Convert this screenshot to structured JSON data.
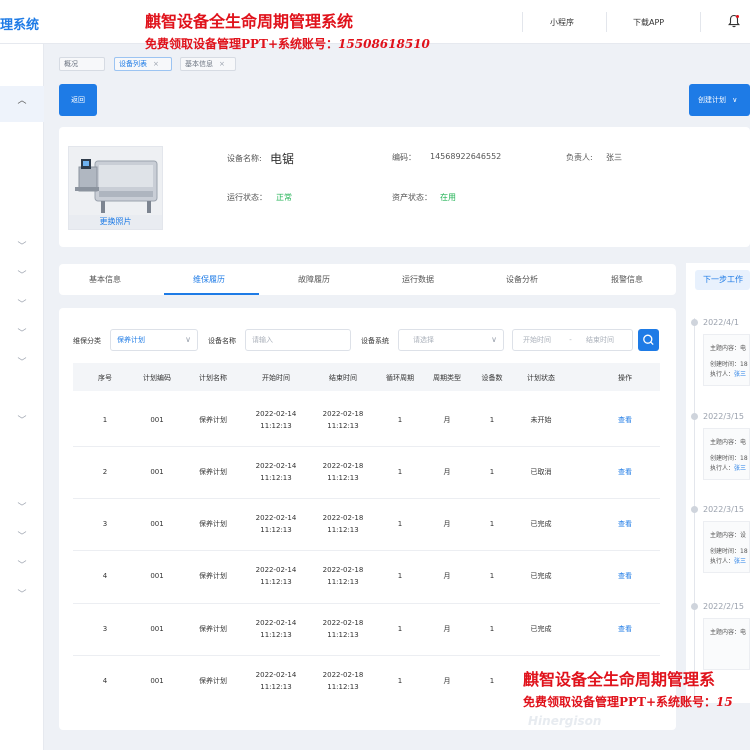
{
  "header": {
    "brand": "理系统",
    "links": [
      "小程序",
      "下载APP"
    ]
  },
  "watermark": {
    "title": "麒智设备全生命周期管理系统",
    "sub_prefix": "免费领取设备管理PPT+系统账号：",
    "phone": "15508618510",
    "title2": "麒智设备全生命周期管理系",
    "sub2_prefix": "免费领取设备管理PPT+系统账号：",
    "phone2": "15",
    "logo_text": "Hinergison"
  },
  "breadcrumbs": [
    "概况",
    "设备列表",
    "基本信息"
  ],
  "buttons": {
    "back": "返回",
    "create_plan": "创建计划"
  },
  "equipment": {
    "photo_caption": "更换照片",
    "name_label": "设备名称:",
    "name_value": "电锯",
    "code_label": "编码：",
    "code_value": "14568922646552",
    "owner_label": "负责人:",
    "owner_value": "张三",
    "run_label": "运行状态：",
    "run_value": "正常",
    "asset_label": "资产状态：",
    "asset_value": "在用"
  },
  "tabs": [
    "基本信息",
    "维保履历",
    "故障履历",
    "运行数据",
    "设备分析",
    "报警信息"
  ],
  "filters": {
    "category_label": "维保分类",
    "category_value": "保养计划",
    "name_label": "设备名称",
    "name_placeholder": "请输入",
    "system_label": "设备系统",
    "system_placeholder": "请选择",
    "start_placeholder": "开始时间",
    "range_sep": "-",
    "end_placeholder": "结束时间"
  },
  "table": {
    "columns": [
      "序号",
      "计划编码",
      "计划名称",
      "开始时间",
      "结束时间",
      "循环周期",
      "周期类型",
      "设备数",
      "计划状态",
      "操作"
    ],
    "rows": [
      {
        "idx": "1",
        "code": "001",
        "name": "保养计划",
        "start_date": "2022-02-14",
        "start_time": "11:12:13",
        "end_date": "2022-02-18",
        "end_time": "11:12:13",
        "cycle": "1",
        "cycle_type": "月",
        "devices": "1",
        "status": "未开始",
        "action": "查看"
      },
      {
        "idx": "2",
        "code": "001",
        "name": "保养计划",
        "start_date": "2022-02-14",
        "start_time": "11:12:13",
        "end_date": "2022-02-18",
        "end_time": "11:12:13",
        "cycle": "1",
        "cycle_type": "月",
        "devices": "1",
        "status": "已取消",
        "action": "查看"
      },
      {
        "idx": "3",
        "code": "001",
        "name": "保养计划",
        "start_date": "2022-02-14",
        "start_time": "11:12:13",
        "end_date": "2022-02-18",
        "end_time": "11:12:13",
        "cycle": "1",
        "cycle_type": "月",
        "devices": "1",
        "status": "已完成",
        "action": "查看"
      },
      {
        "idx": "4",
        "code": "001",
        "name": "保养计划",
        "start_date": "2022-02-14",
        "start_time": "11:12:13",
        "end_date": "2022-02-18",
        "end_time": "11:12:13",
        "cycle": "1",
        "cycle_type": "月",
        "devices": "1",
        "status": "已完成",
        "action": "查看"
      },
      {
        "idx": "3",
        "code": "001",
        "name": "保养计划",
        "start_date": "2022-02-14",
        "start_time": "11:12:13",
        "end_date": "2022-02-18",
        "end_time": "11:12:13",
        "cycle": "1",
        "cycle_type": "月",
        "devices": "1",
        "status": "已完成",
        "action": "查看"
      },
      {
        "idx": "4",
        "code": "001",
        "name": "保养计划",
        "start_date": "2022-02-14",
        "start_time": "11:12:13",
        "end_date": "2022-02-18",
        "end_time": "11:12:13",
        "cycle": "1",
        "cycle_type": "月",
        "devices": "1",
        "status": "",
        "action": ""
      }
    ]
  },
  "timeline": {
    "title": "下一步工作",
    "items": [
      {
        "date": "2022/4/1",
        "content": "主题内容：电",
        "created": "创建时间：18",
        "executor_label": "执行人：",
        "executor": "张三"
      },
      {
        "date": "2022/3/15",
        "content": "主题内容：电",
        "created": "创建时间：18",
        "executor_label": "执行人：",
        "executor": "张三"
      },
      {
        "date": "2022/3/15",
        "content": "主题内容：设",
        "created": "创建时间：18",
        "executor_label": "执行人：",
        "executor": "张三"
      },
      {
        "date": "2022/2/15",
        "content": "主题内容：电",
        "created": "",
        "executor_label": "",
        "executor": ""
      }
    ]
  },
  "colors": {
    "accent": "#1e7be6",
    "success": "#23b356",
    "watermark": "#e0121b"
  },
  "icons": [
    "bell-icon",
    "chevron-up-icon",
    "chevron-down-icon",
    "search-icon",
    "close-icon"
  ]
}
